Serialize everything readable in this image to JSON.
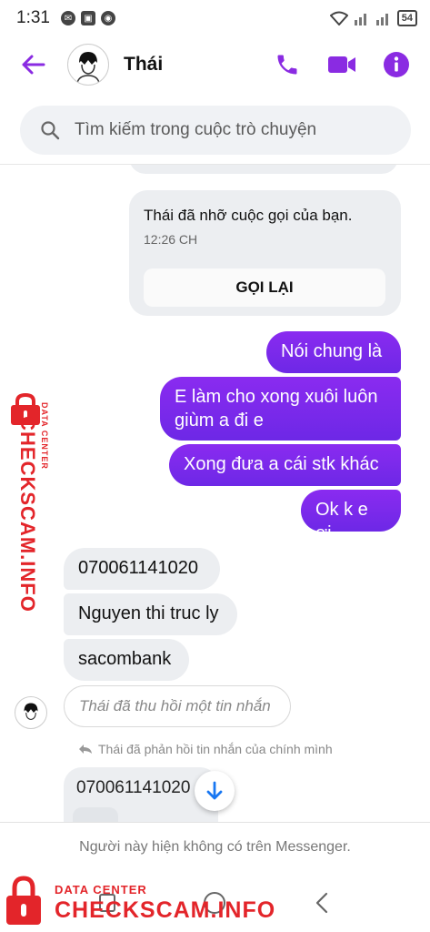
{
  "status_bar": {
    "time": "1:31",
    "battery": "54"
  },
  "header": {
    "contact_name": "Thái"
  },
  "search": {
    "placeholder": "Tìm kiếm trong cuộc trò chuyện"
  },
  "missed_call": {
    "text": "Thái đã nhỡ cuộc gọi của bạn.",
    "time": "12:26 CH",
    "call_back_label": "GỌI LẠI"
  },
  "outgoing_messages": [
    "Nói chung là",
    "E làm cho xong xuôi luôn giùm a đi e",
    "Xong đưa a cái stk khác",
    "Ok k e ơi"
  ],
  "incoming_messages": [
    "070061141020",
    "Nguyen thi truc ly",
    "sacombank"
  ],
  "recalled_message": "Thái đã thu hồi một tin nhắn",
  "reply_note": "Thái đã phản hồi tin nhắn của chính mình",
  "reply_preview": "070061141020",
  "notice": "Người này hiện không có trên Messenger.",
  "watermark": {
    "subtitle": "DATA CENTER",
    "title": "CHECKSCAM.INFO"
  },
  "colors": {
    "accent": "#8a2be2",
    "outgoing_bubble": "#7b2ff0",
    "incoming_bubble": "#eceef1",
    "watermark": "#e3252a"
  }
}
